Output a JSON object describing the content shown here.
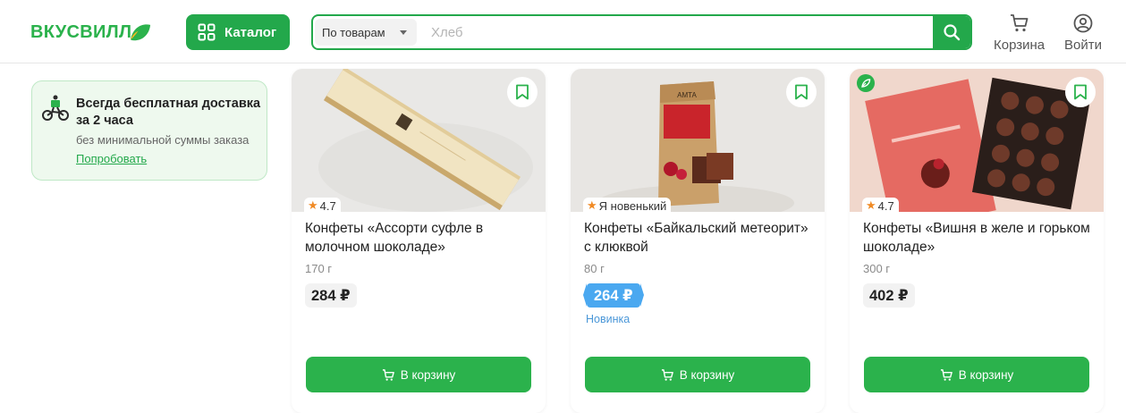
{
  "header": {
    "logo_text": "ВКУСВИЛЛ",
    "catalog_label": "Каталог",
    "search_scope": "По товарам",
    "search_placeholder": "Хлеб",
    "cart_label": "Корзина",
    "login_label": "Войти"
  },
  "promo": {
    "title": "Всегда бесплатная доставка за 2 часа",
    "subtitle": "без минимальной суммы заказа",
    "link": "Попробовать"
  },
  "products": [
    {
      "badge": "4.7",
      "name": "Конфеты «Ассорти суфле в молочном шоколаде»",
      "weight": "170 г",
      "price": "284 ₽",
      "tag": "",
      "cart_label": "В корзину"
    },
    {
      "badge": "Я новенький",
      "name": "Конфеты «Байкальский метеорит» с клюквой",
      "weight": "80 г",
      "price": "264 ₽",
      "tag": "Новинка",
      "cart_label": "В корзину"
    },
    {
      "badge": "4.7",
      "name": "Конфеты «Вишня в желе и горьком шоколаде»",
      "weight": "300 г",
      "price": "402 ₽",
      "tag": "",
      "cart_label": "В корзину"
    }
  ],
  "colors": {
    "brand_green": "#23a84b",
    "new_price_blue": "#4aa8f0",
    "rating_star": "#f08a24"
  },
  "icons": [
    "grid-icon",
    "search-icon",
    "cart-icon",
    "user-icon",
    "bicycle-courier-icon",
    "bookmark-icon",
    "leaf-icon",
    "star-icon"
  ]
}
